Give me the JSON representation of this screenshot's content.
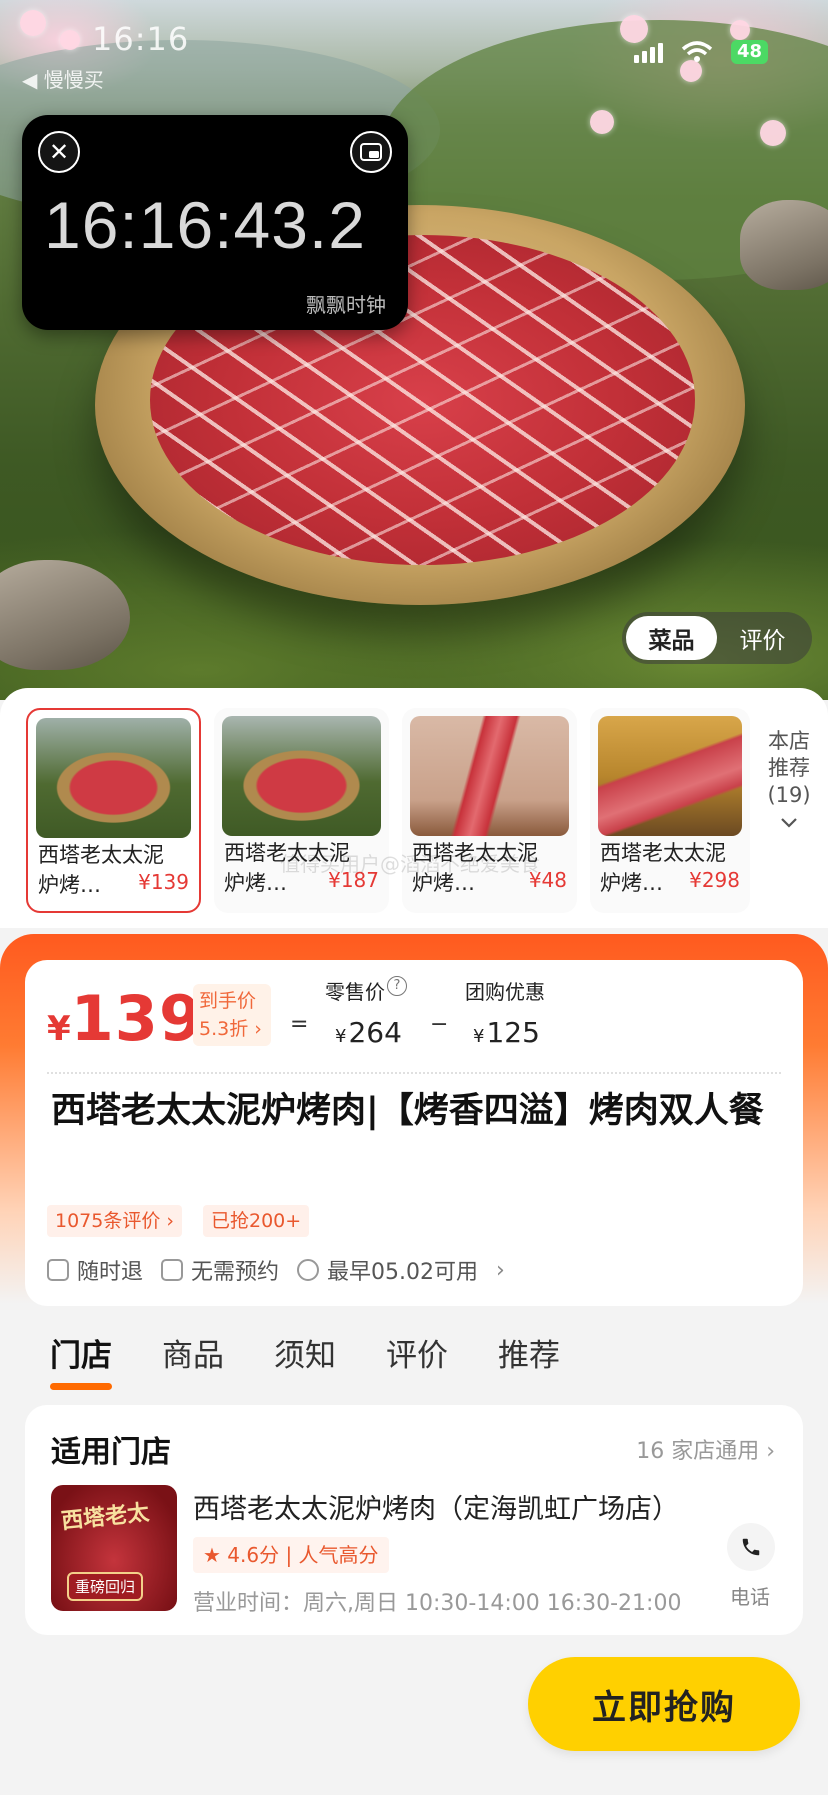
{
  "status_bar": {
    "time": "16:16",
    "back_app": "◀ 慢慢买",
    "battery": "48"
  },
  "floating_clock": {
    "time": "16:16:43.2",
    "label": "飘飘时钟"
  },
  "hero_tabs": [
    {
      "label": "菜品"
    },
    {
      "label": "评价"
    }
  ],
  "thumbnails": [
    {
      "name_line1": "西塔老太太泥",
      "name_line2": "炉烤…",
      "price": "¥139"
    },
    {
      "name_line1": "西塔老太太泥",
      "name_line2": "炉烤…",
      "price": "¥187"
    },
    {
      "name_line1": "西塔老太太泥",
      "name_line2": "炉烤…",
      "price": "¥48"
    },
    {
      "name_line1": "西塔老太太泥",
      "name_line2": "炉烤…",
      "price": "¥298"
    }
  ],
  "recommend": {
    "line1": "本店",
    "line2": "推荐",
    "count": "(19)"
  },
  "watermark": "值得买用户@滔滔不绝爱美食",
  "price_card": {
    "currency": "¥",
    "final_price": "139",
    "discount_line1": "到手价",
    "discount_line2": "5.3折",
    "retail_label": "零售价",
    "retail_currency": "¥",
    "retail_value": "264",
    "group_label": "团购优惠",
    "group_currency": "¥",
    "group_value": "125",
    "title": "西塔老太太泥炉烤肉|【烤香四溢】烤肉双人餐",
    "chip_reviews": "1075条评价",
    "chip_sold": "已抢200+",
    "feature_refund": "随时退",
    "feature_no_booking": "无需预约",
    "feature_earliest": "最早05.02可用"
  },
  "nav_tabs": [
    {
      "label": "门店"
    },
    {
      "label": "商品"
    },
    {
      "label": "须知"
    },
    {
      "label": "评价"
    },
    {
      "label": "推荐"
    }
  ],
  "store": {
    "heading": "适用门店",
    "count_text": "16 家店通用",
    "img_text": "西塔老太",
    "img_badge": "重磅回归",
    "name": "西塔老太太泥炉烤肉（定海凯虹广场店）",
    "rating": "4.6分 | 人气高分",
    "hours": "营业时间：周六,周日 10:30-14:00 16:30-21:00",
    "phone_label": "电话"
  },
  "buy_button": "立即抢购",
  "colors": {
    "accent_red": "#e53935",
    "accent_orange": "#ff6a00",
    "buy_yellow": "#ffd000"
  }
}
